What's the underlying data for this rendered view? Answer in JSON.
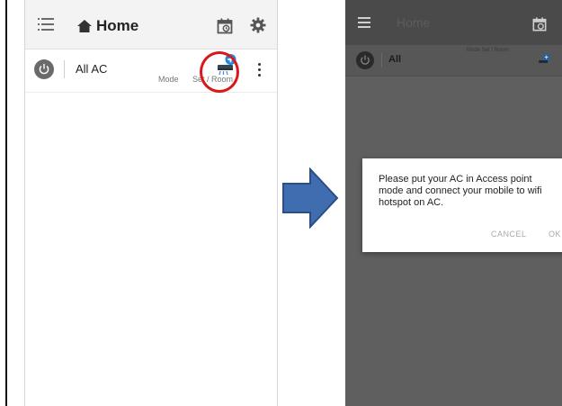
{
  "left_screen": {
    "title": "Home",
    "row": {
      "title": "All AC",
      "mode_label": "Mode",
      "set_room_label": "Set / Room"
    }
  },
  "right_screen": {
    "title": "Home",
    "row": {
      "title": "All",
      "mode_set_room": "Mode  Set / Room"
    },
    "dialog": {
      "message": "Please put your AC in Access point mode and connect your mobile to wifi hotspot on AC.",
      "cancel_label": "CANCEL",
      "ok_label": "OK"
    }
  },
  "colors": {
    "highlight_circle": "#d8191c",
    "arrow_fill": "#3f6db0",
    "add_icon_blue": "#1e88e5"
  },
  "icons": [
    "menu-icon",
    "home-icon",
    "calendar-icon",
    "gear-icon",
    "power-icon",
    "add-ac-icon",
    "more-vert-icon",
    "arrow-right-icon"
  ]
}
